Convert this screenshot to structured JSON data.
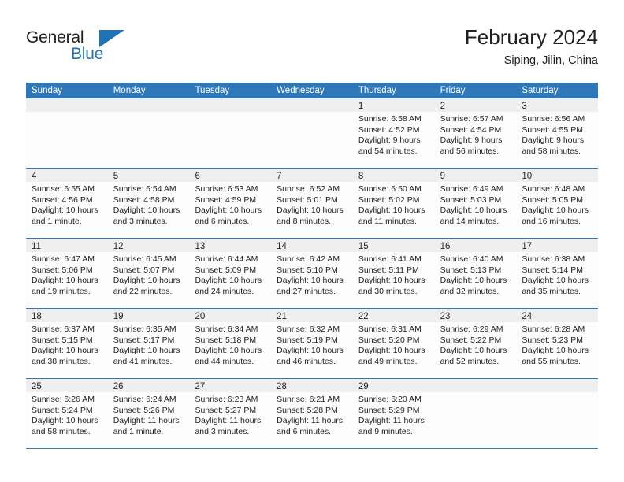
{
  "logo": {
    "word_top": "General",
    "word_bottom": "Blue",
    "accent_color": "#2272b6"
  },
  "header": {
    "title": "February 2024",
    "subtitle": "Siping, Jilin, China"
  },
  "theme": {
    "header_blue": "#2e78b8",
    "daynum_band": "#efefef",
    "text": "#231f20"
  },
  "weekdays": [
    "Sunday",
    "Monday",
    "Tuesday",
    "Wednesday",
    "Thursday",
    "Friday",
    "Saturday"
  ],
  "weeks": [
    [
      {
        "day": "",
        "sunrise": "",
        "sunset": "",
        "daylight1": "",
        "daylight2": ""
      },
      {
        "day": "",
        "sunrise": "",
        "sunset": "",
        "daylight1": "",
        "daylight2": ""
      },
      {
        "day": "",
        "sunrise": "",
        "sunset": "",
        "daylight1": "",
        "daylight2": ""
      },
      {
        "day": "",
        "sunrise": "",
        "sunset": "",
        "daylight1": "",
        "daylight2": ""
      },
      {
        "day": "1",
        "sunrise": "Sunrise: 6:58 AM",
        "sunset": "Sunset: 4:52 PM",
        "daylight1": "Daylight: 9 hours",
        "daylight2": "and 54 minutes."
      },
      {
        "day": "2",
        "sunrise": "Sunrise: 6:57 AM",
        "sunset": "Sunset: 4:54 PM",
        "daylight1": "Daylight: 9 hours",
        "daylight2": "and 56 minutes."
      },
      {
        "day": "3",
        "sunrise": "Sunrise: 6:56 AM",
        "sunset": "Sunset: 4:55 PM",
        "daylight1": "Daylight: 9 hours",
        "daylight2": "and 58 minutes."
      }
    ],
    [
      {
        "day": "4",
        "sunrise": "Sunrise: 6:55 AM",
        "sunset": "Sunset: 4:56 PM",
        "daylight1": "Daylight: 10 hours",
        "daylight2": "and 1 minute."
      },
      {
        "day": "5",
        "sunrise": "Sunrise: 6:54 AM",
        "sunset": "Sunset: 4:58 PM",
        "daylight1": "Daylight: 10 hours",
        "daylight2": "and 3 minutes."
      },
      {
        "day": "6",
        "sunrise": "Sunrise: 6:53 AM",
        "sunset": "Sunset: 4:59 PM",
        "daylight1": "Daylight: 10 hours",
        "daylight2": "and 6 minutes."
      },
      {
        "day": "7",
        "sunrise": "Sunrise: 6:52 AM",
        "sunset": "Sunset: 5:01 PM",
        "daylight1": "Daylight: 10 hours",
        "daylight2": "and 8 minutes."
      },
      {
        "day": "8",
        "sunrise": "Sunrise: 6:50 AM",
        "sunset": "Sunset: 5:02 PM",
        "daylight1": "Daylight: 10 hours",
        "daylight2": "and 11 minutes."
      },
      {
        "day": "9",
        "sunrise": "Sunrise: 6:49 AM",
        "sunset": "Sunset: 5:03 PM",
        "daylight1": "Daylight: 10 hours",
        "daylight2": "and 14 minutes."
      },
      {
        "day": "10",
        "sunrise": "Sunrise: 6:48 AM",
        "sunset": "Sunset: 5:05 PM",
        "daylight1": "Daylight: 10 hours",
        "daylight2": "and 16 minutes."
      }
    ],
    [
      {
        "day": "11",
        "sunrise": "Sunrise: 6:47 AM",
        "sunset": "Sunset: 5:06 PM",
        "daylight1": "Daylight: 10 hours",
        "daylight2": "and 19 minutes."
      },
      {
        "day": "12",
        "sunrise": "Sunrise: 6:45 AM",
        "sunset": "Sunset: 5:07 PM",
        "daylight1": "Daylight: 10 hours",
        "daylight2": "and 22 minutes."
      },
      {
        "day": "13",
        "sunrise": "Sunrise: 6:44 AM",
        "sunset": "Sunset: 5:09 PM",
        "daylight1": "Daylight: 10 hours",
        "daylight2": "and 24 minutes."
      },
      {
        "day": "14",
        "sunrise": "Sunrise: 6:42 AM",
        "sunset": "Sunset: 5:10 PM",
        "daylight1": "Daylight: 10 hours",
        "daylight2": "and 27 minutes."
      },
      {
        "day": "15",
        "sunrise": "Sunrise: 6:41 AM",
        "sunset": "Sunset: 5:11 PM",
        "daylight1": "Daylight: 10 hours",
        "daylight2": "and 30 minutes."
      },
      {
        "day": "16",
        "sunrise": "Sunrise: 6:40 AM",
        "sunset": "Sunset: 5:13 PM",
        "daylight1": "Daylight: 10 hours",
        "daylight2": "and 32 minutes."
      },
      {
        "day": "17",
        "sunrise": "Sunrise: 6:38 AM",
        "sunset": "Sunset: 5:14 PM",
        "daylight1": "Daylight: 10 hours",
        "daylight2": "and 35 minutes."
      }
    ],
    [
      {
        "day": "18",
        "sunrise": "Sunrise: 6:37 AM",
        "sunset": "Sunset: 5:15 PM",
        "daylight1": "Daylight: 10 hours",
        "daylight2": "and 38 minutes."
      },
      {
        "day": "19",
        "sunrise": "Sunrise: 6:35 AM",
        "sunset": "Sunset: 5:17 PM",
        "daylight1": "Daylight: 10 hours",
        "daylight2": "and 41 minutes."
      },
      {
        "day": "20",
        "sunrise": "Sunrise: 6:34 AM",
        "sunset": "Sunset: 5:18 PM",
        "daylight1": "Daylight: 10 hours",
        "daylight2": "and 44 minutes."
      },
      {
        "day": "21",
        "sunrise": "Sunrise: 6:32 AM",
        "sunset": "Sunset: 5:19 PM",
        "daylight1": "Daylight: 10 hours",
        "daylight2": "and 46 minutes."
      },
      {
        "day": "22",
        "sunrise": "Sunrise: 6:31 AM",
        "sunset": "Sunset: 5:20 PM",
        "daylight1": "Daylight: 10 hours",
        "daylight2": "and 49 minutes."
      },
      {
        "day": "23",
        "sunrise": "Sunrise: 6:29 AM",
        "sunset": "Sunset: 5:22 PM",
        "daylight1": "Daylight: 10 hours",
        "daylight2": "and 52 minutes."
      },
      {
        "day": "24",
        "sunrise": "Sunrise: 6:28 AM",
        "sunset": "Sunset: 5:23 PM",
        "daylight1": "Daylight: 10 hours",
        "daylight2": "and 55 minutes."
      }
    ],
    [
      {
        "day": "25",
        "sunrise": "Sunrise: 6:26 AM",
        "sunset": "Sunset: 5:24 PM",
        "daylight1": "Daylight: 10 hours",
        "daylight2": "and 58 minutes."
      },
      {
        "day": "26",
        "sunrise": "Sunrise: 6:24 AM",
        "sunset": "Sunset: 5:26 PM",
        "daylight1": "Daylight: 11 hours",
        "daylight2": "and 1 minute."
      },
      {
        "day": "27",
        "sunrise": "Sunrise: 6:23 AM",
        "sunset": "Sunset: 5:27 PM",
        "daylight1": "Daylight: 11 hours",
        "daylight2": "and 3 minutes."
      },
      {
        "day": "28",
        "sunrise": "Sunrise: 6:21 AM",
        "sunset": "Sunset: 5:28 PM",
        "daylight1": "Daylight: 11 hours",
        "daylight2": "and 6 minutes."
      },
      {
        "day": "29",
        "sunrise": "Sunrise: 6:20 AM",
        "sunset": "Sunset: 5:29 PM",
        "daylight1": "Daylight: 11 hours",
        "daylight2": "and 9 minutes."
      },
      {
        "day": "",
        "sunrise": "",
        "sunset": "",
        "daylight1": "",
        "daylight2": ""
      },
      {
        "day": "",
        "sunrise": "",
        "sunset": "",
        "daylight1": "",
        "daylight2": ""
      }
    ]
  ]
}
